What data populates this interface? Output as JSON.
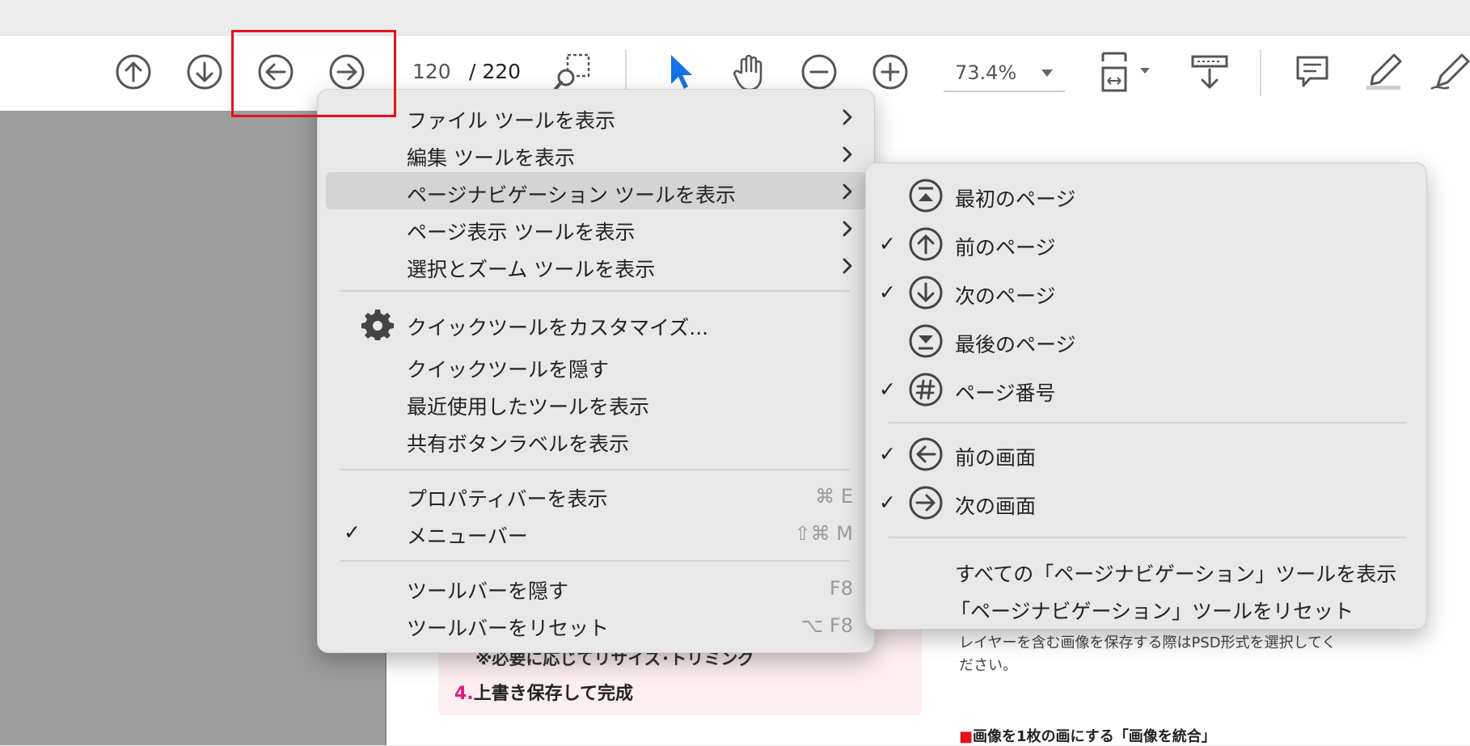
{
  "toolbar": {
    "current_page": "120",
    "page_total": "/  220",
    "zoom": "73.4%",
    "icons": [
      "arrow-up-circle",
      "arrow-down-circle",
      "arrow-left-circle",
      "arrow-right-circle",
      "marquee-zoom",
      "select-pointer",
      "hand",
      "zoom-out",
      "zoom-in",
      "page-fit",
      "scroll",
      "comment",
      "highlighter",
      "pen-sign"
    ],
    "pointer_color": "#1473e6",
    "highlight_box_color": "#e3121b"
  },
  "document": {
    "note": "※必要に応じてリサイズ･トリミング",
    "step_number": "4.",
    "step_text": "上書き保存して完成",
    "right_text": "レイヤーを含む画像を保存する際はPSD形式を選択してください。",
    "right_heading_square": "■",
    "right_heading": "画像を1枚の画にする「画像を統合」"
  },
  "menu": {
    "items": [
      {
        "label": "ファイル ツールを表示"
      },
      {
        "label": "編集 ツールを表示"
      },
      {
        "label": "ページナビゲーション ツールを表示"
      },
      {
        "label": "ページ表示 ツールを表示"
      },
      {
        "label": "選択とズーム ツールを表示"
      },
      {
        "label": "クイックツールをカスタマイズ..."
      },
      {
        "label": "クイックツールを隠す"
      },
      {
        "label": "最近使用したツールを表示"
      },
      {
        "label": "共有ボタンラベルを表示"
      },
      {
        "label": "プロパティバーを表示",
        "shortcut": "⌘ E"
      },
      {
        "label": "メニューバー",
        "shortcut": "⇧⌘ M",
        "check": "✓"
      },
      {
        "label": "ツールバーを隠す",
        "shortcut": "F8"
      },
      {
        "label": "ツールバーをリセット",
        "shortcut": "⌥ F8"
      }
    ]
  },
  "submenu": {
    "items": [
      {
        "label": "最初のページ",
        "icon": "first-page-icon"
      },
      {
        "label": "前のページ",
        "icon": "previous-page-icon",
        "check": "✓"
      },
      {
        "label": "次のページ",
        "icon": "next-page-icon",
        "check": "✓"
      },
      {
        "label": "最後のページ",
        "icon": "last-page-icon"
      },
      {
        "label": "ページ番号",
        "icon": "page-number-icon",
        "check": "✓"
      },
      {
        "label": "前の画面",
        "icon": "previous-view-icon",
        "check": "✓"
      },
      {
        "label": "次の画面",
        "icon": "next-view-icon",
        "check": "✓"
      },
      {
        "label": "すべての「ページナビゲーション」ツールを表示"
      },
      {
        "label": "「ページナビゲーション」ツールをリセット"
      }
    ]
  }
}
